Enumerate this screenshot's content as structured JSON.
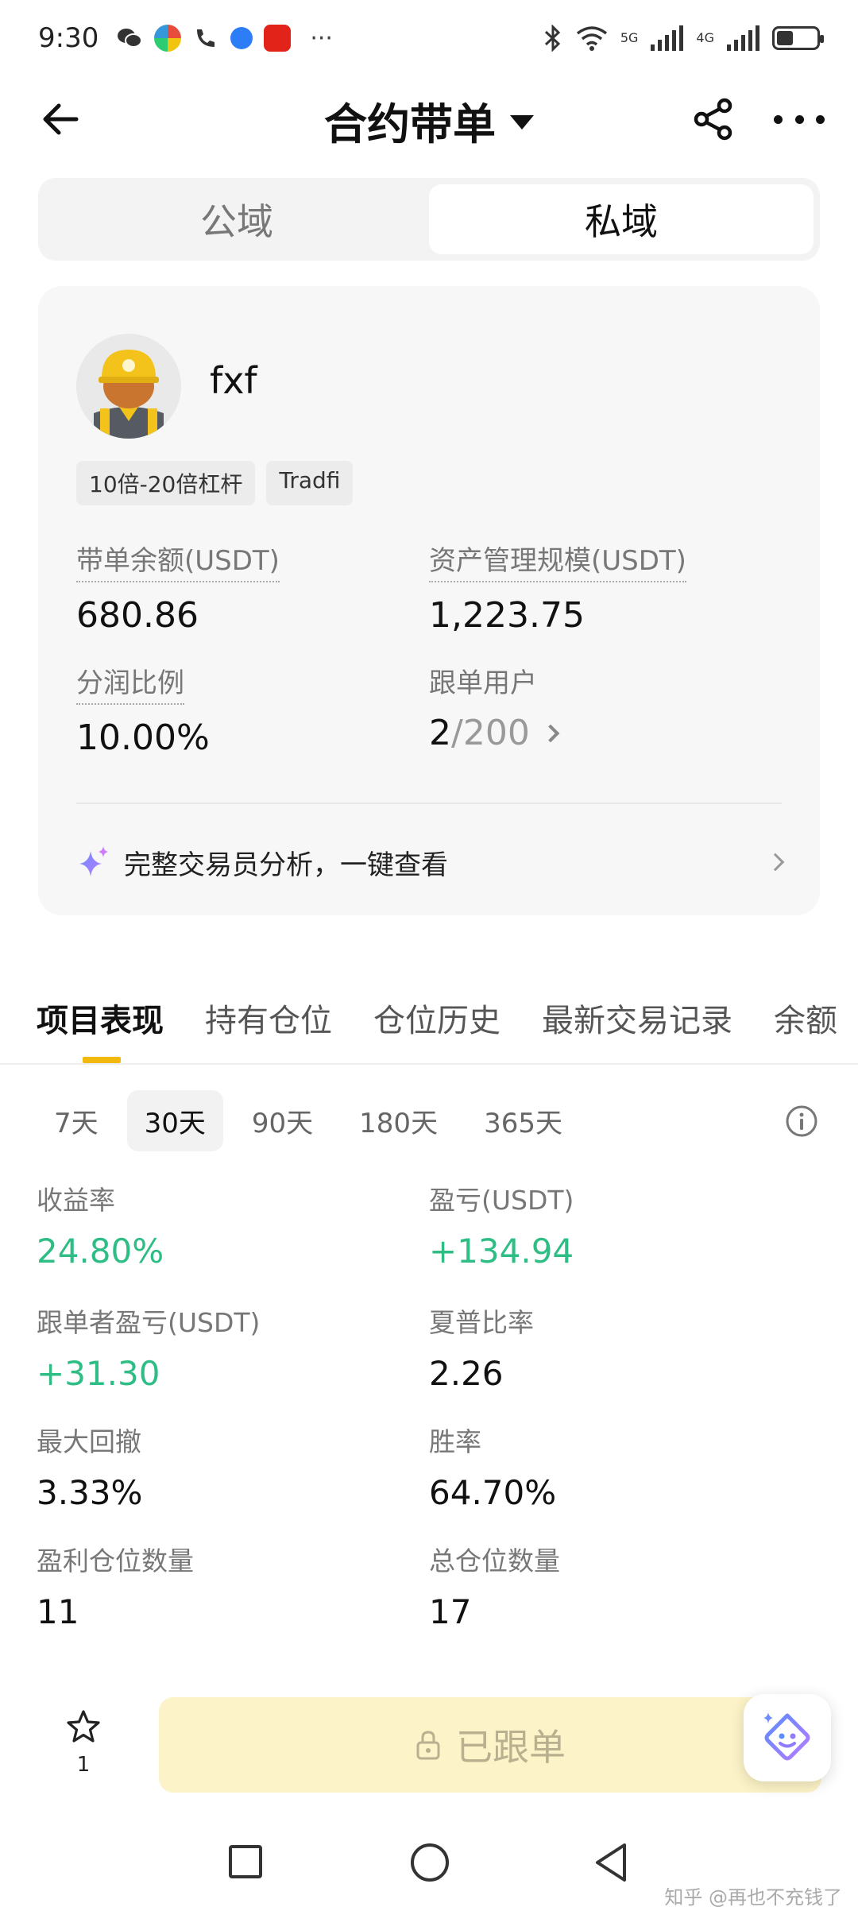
{
  "status_bar": {
    "time": "9:30",
    "net1": "5G",
    "net2": "4G",
    "more": "···"
  },
  "header": {
    "title": "合约带单"
  },
  "segment": {
    "tabs": [
      {
        "label": "公域",
        "active": false
      },
      {
        "label": "私域",
        "active": true
      }
    ]
  },
  "trader": {
    "name": "fxf",
    "tags": [
      "10倍-20倍杠杆",
      "Tradfi"
    ],
    "stats": {
      "balance_label": "带单余额(USDT)",
      "balance_value": "680.86",
      "aum_label": "资产管理规模(USDT)",
      "aum_value": "1,223.75",
      "profit_share_label": "分润比例",
      "profit_share_value": "10.00%",
      "followers_label": "跟单用户",
      "followers_current": "2",
      "followers_max": "/200"
    },
    "analysis_text": "完整交易员分析，一键查看"
  },
  "tabs": [
    {
      "label": "项目表现",
      "active": true
    },
    {
      "label": "持有仓位",
      "active": false
    },
    {
      "label": "仓位历史",
      "active": false
    },
    {
      "label": "最新交易记录",
      "active": false
    },
    {
      "label": "余额",
      "active": false
    }
  ],
  "periods": [
    {
      "label": "7天",
      "active": false
    },
    {
      "label": "30天",
      "active": true
    },
    {
      "label": "90天",
      "active": false
    },
    {
      "label": "180天",
      "active": false
    },
    {
      "label": "365天",
      "active": false
    }
  ],
  "metrics": {
    "roi_label": "收益率",
    "roi_value": "24.80%",
    "pnl_label": "盈亏(USDT)",
    "pnl_value": "+134.94",
    "follower_pnl_label": "跟单者盈亏(USDT)",
    "follower_pnl_value": "+31.30",
    "sharpe_label": "夏普比率",
    "sharpe_value": "2.26",
    "mdd_label": "最大回撤",
    "mdd_value": "3.33%",
    "winrate_label": "胜率",
    "winrate_value": "64.70%",
    "win_positions_label": "盈利仓位数量",
    "win_positions_value": "11",
    "total_positions_label": "总仓位数量",
    "total_positions_value": "17"
  },
  "bottom": {
    "fav_count": "1",
    "follow_label": "已跟单"
  },
  "watermark": "知乎 @再也不充钱了",
  "colors": {
    "accent": "#f0b90b",
    "positive": "#2ebd85",
    "follow_bg": "#fdf3c8"
  }
}
